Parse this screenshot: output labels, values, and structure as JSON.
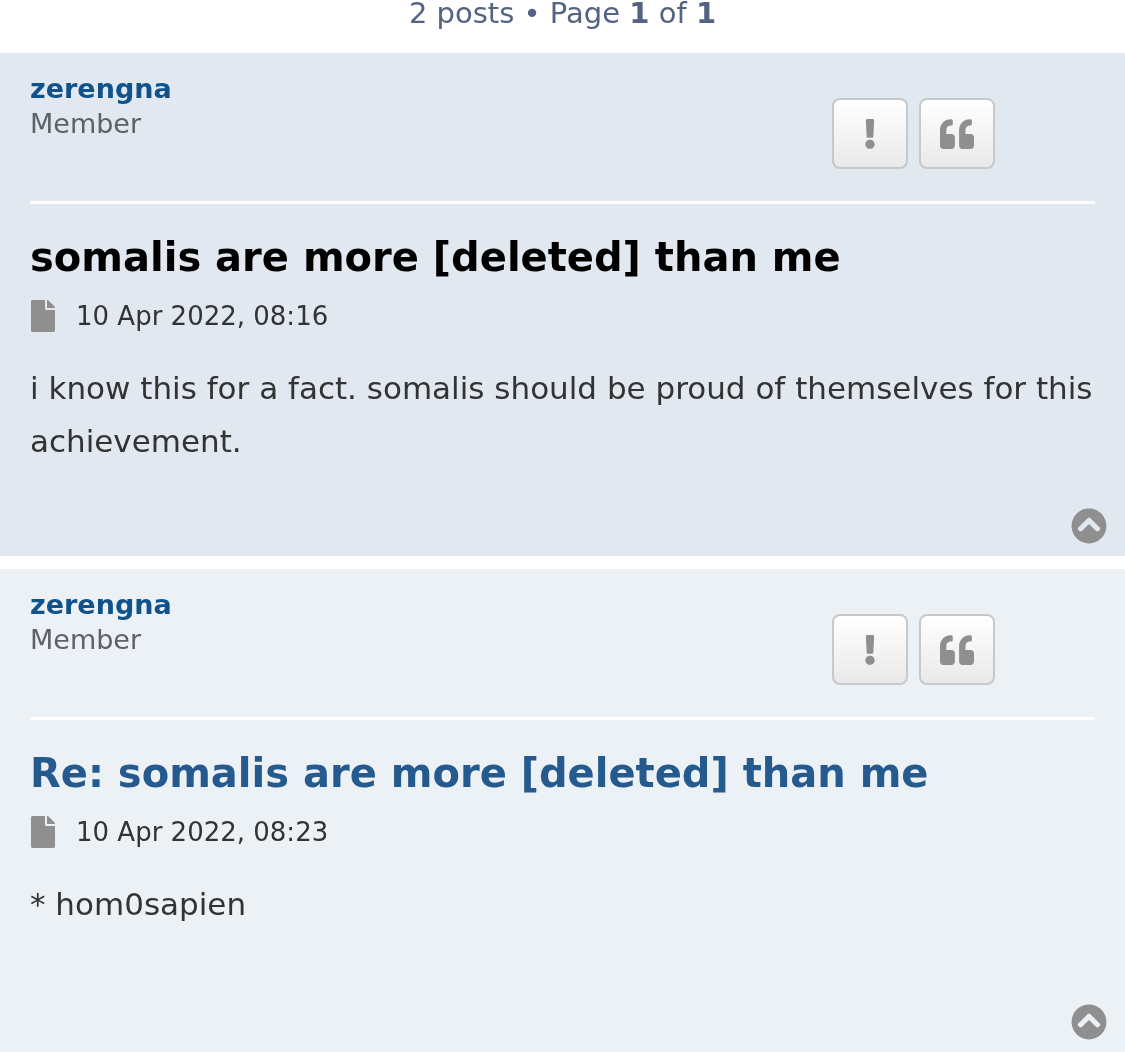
{
  "pagination": {
    "text": "2 posts • Page **1** of **1**"
  },
  "posts": [
    {
      "kind": "first",
      "author": "zerengna",
      "rank": "Member",
      "title": "somalis are more [deleted] than me",
      "date": "10 Apr 2022, 08:16",
      "body": "i know this for a fact. somalis should be proud of themselves for this achievement."
    },
    {
      "kind": "reply",
      "author": "zerengna",
      "rank": "Member",
      "title": "Re: somalis are more [deleted] than me",
      "date": "10 Apr 2022, 08:23",
      "body": "* hom0sapien"
    }
  ]
}
